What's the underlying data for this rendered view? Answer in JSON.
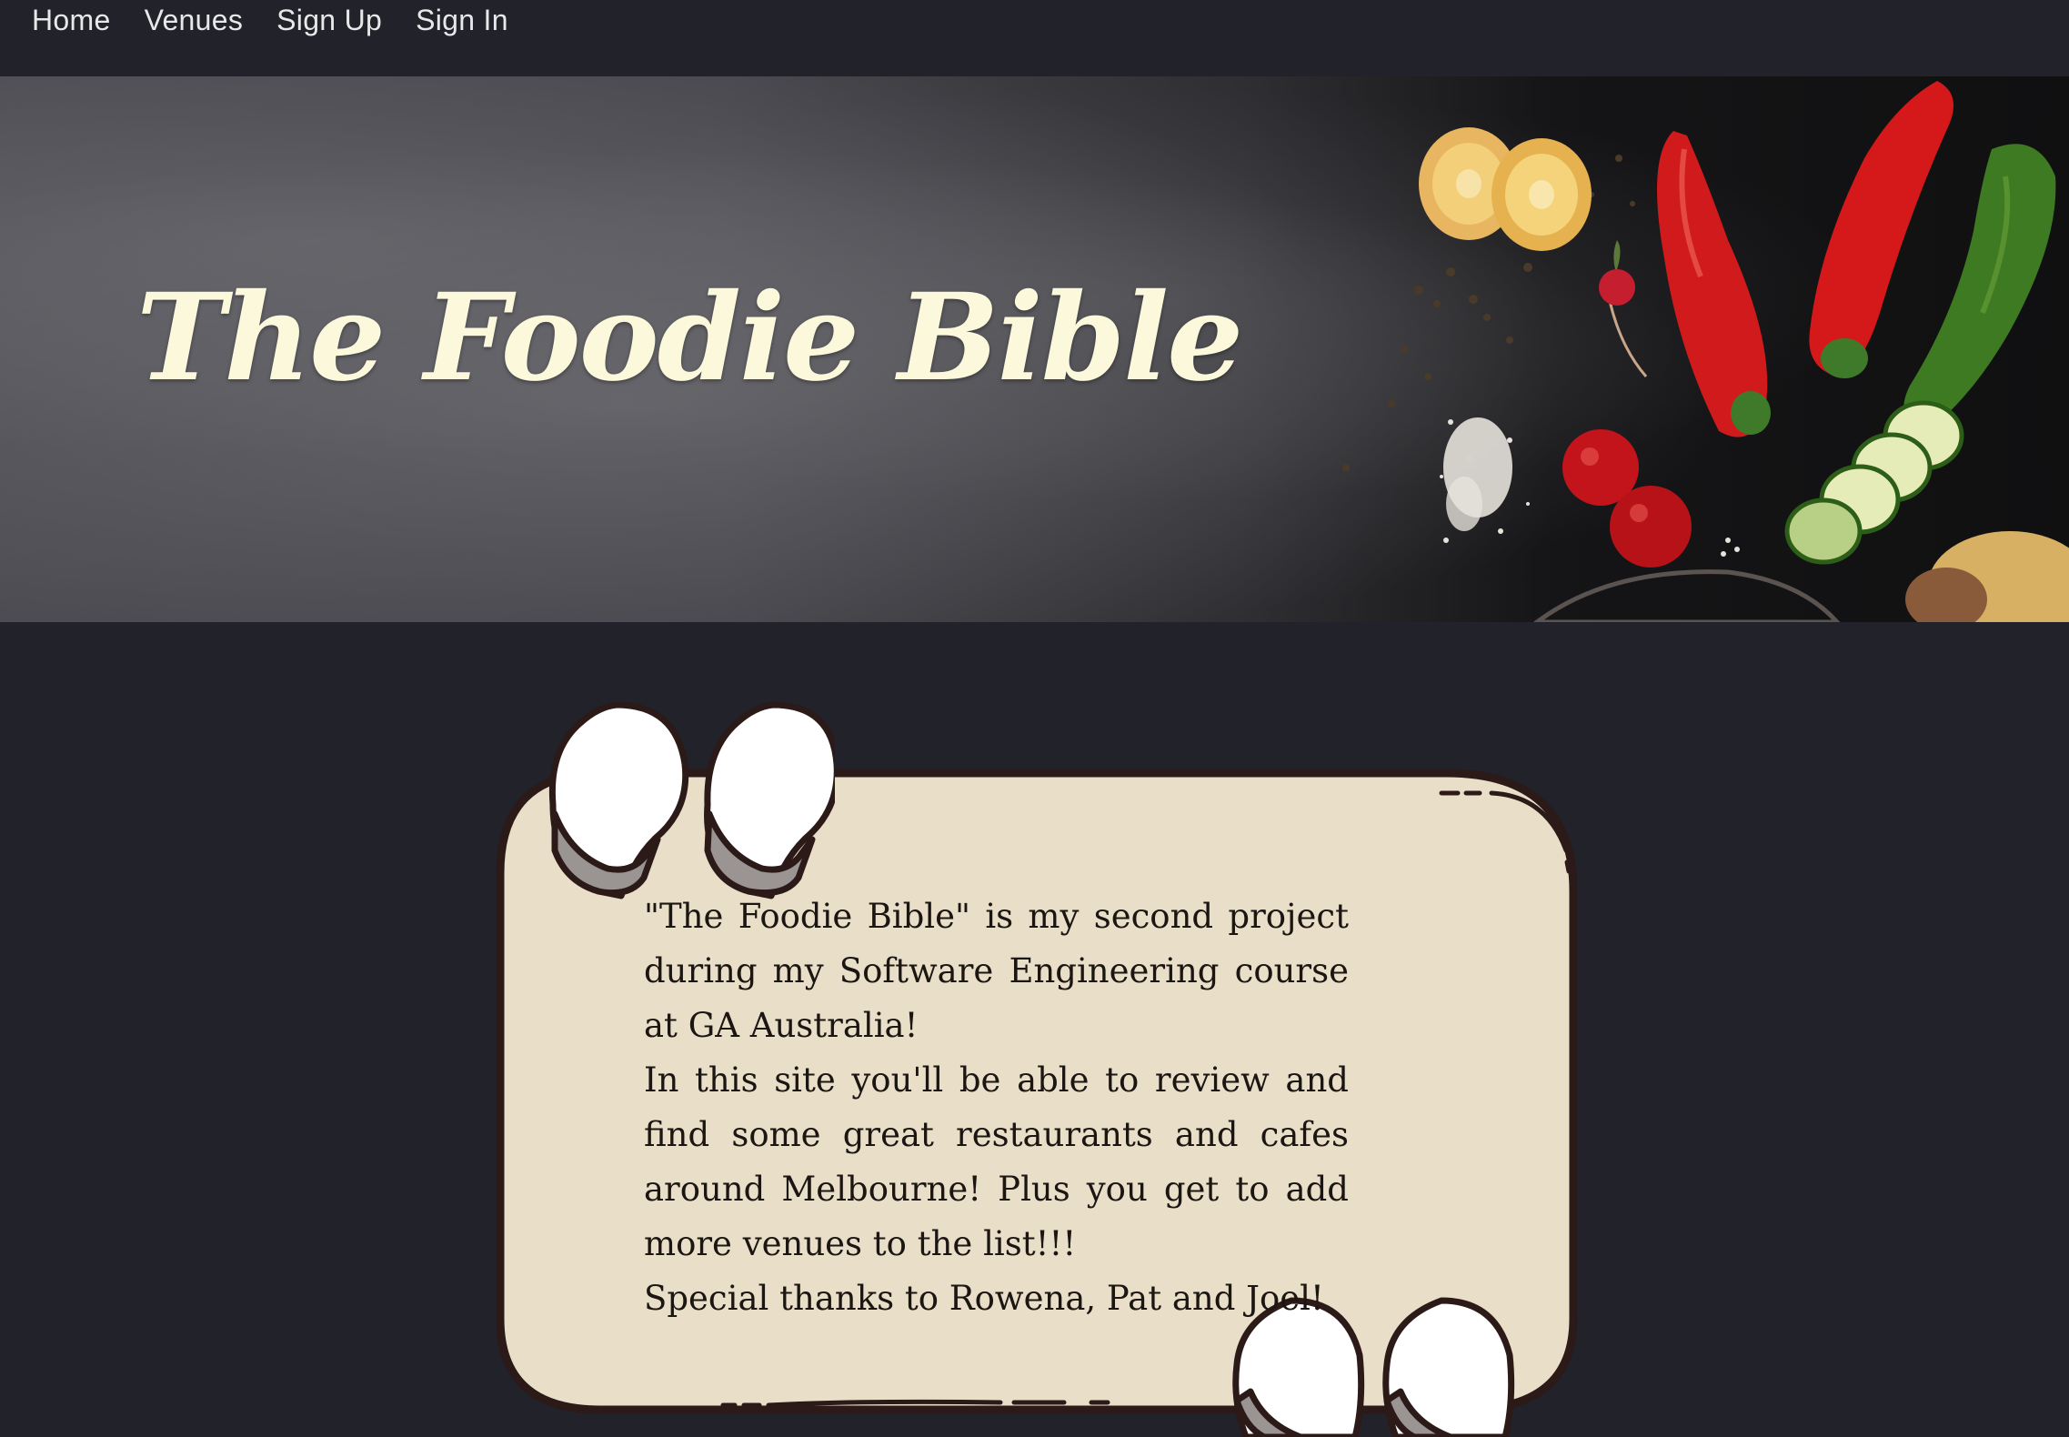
{
  "nav": {
    "items": [
      {
        "label": "Home"
      },
      {
        "label": "Venues"
      },
      {
        "label": "Sign Up"
      },
      {
        "label": "Sign In"
      }
    ]
  },
  "hero": {
    "title": "The Foodie Bible"
  },
  "about": {
    "paragraphs": [
      "\"The Foodie Bible\" is my second project during my Software Engineering course at GA Australia!",
      "In this site you'll be able to review and find some great restaurants and cafes around Melbourne! Plus you get to add more venues to the list!!!",
      "Special thanks to Rowena, Pat and Joel!"
    ]
  },
  "colors": {
    "background": "#21222a",
    "nav_text": "#e8e8e8",
    "title_text": "#fbf8dc",
    "card_fill": "#e9dfc8",
    "card_outline": "#2b1a17"
  }
}
